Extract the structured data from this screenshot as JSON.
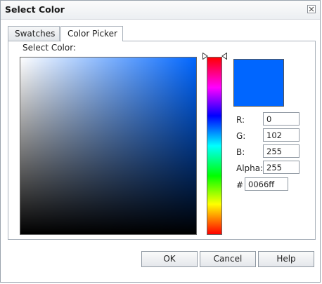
{
  "window": {
    "title": "Select Color"
  },
  "tabs": [
    {
      "label": "Swatches",
      "active": false
    },
    {
      "label": "Color Picker",
      "active": true
    }
  ],
  "picker": {
    "section_label": "Select Color:",
    "selected_hue_color": "#0066ff",
    "preview_color": "#0066ff",
    "fields": {
      "r_label": "R:",
      "r_value": "0",
      "g_label": "G:",
      "g_value": "102",
      "b_label": "B:",
      "b_value": "255",
      "alpha_label": "Alpha:",
      "alpha_value": "255",
      "hex_label": "#",
      "hex_value": "0066ff"
    }
  },
  "buttons": {
    "ok": "OK",
    "cancel": "Cancel",
    "help": "Help"
  }
}
